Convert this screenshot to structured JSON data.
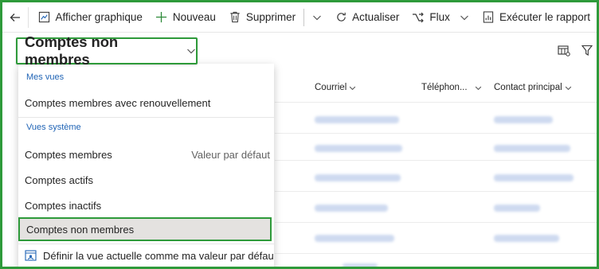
{
  "toolbar": {
    "show_chart": "Afficher graphique",
    "new": "Nouveau",
    "delete": "Supprimer",
    "refresh": "Actualiser",
    "flow": "Flux",
    "run_report": "Exécuter le rapport"
  },
  "view_selector": {
    "title": "Comptes non membres"
  },
  "grid": {
    "columns": [
      "Courriel",
      "Téléphon...",
      "Contact principal"
    ]
  },
  "dropdown": {
    "my_views_label": "Mes vues",
    "my_views": [
      "Comptes membres avec renouvellement"
    ],
    "system_views_label": "Vues système",
    "system_views": [
      {
        "label": "Comptes membres",
        "note": "Valeur par défaut"
      },
      {
        "label": "Comptes actifs",
        "note": ""
      },
      {
        "label": "Comptes inactifs",
        "note": ""
      },
      {
        "label": "Comptes non membres",
        "note": ""
      }
    ],
    "set_default": "Définir la vue actuelle comme ma valeur par défaut"
  },
  "colors": {
    "accent_green": "#2e9a3a",
    "link_blue": "#1f63b5",
    "selected_bg": "#e4e2e0"
  }
}
